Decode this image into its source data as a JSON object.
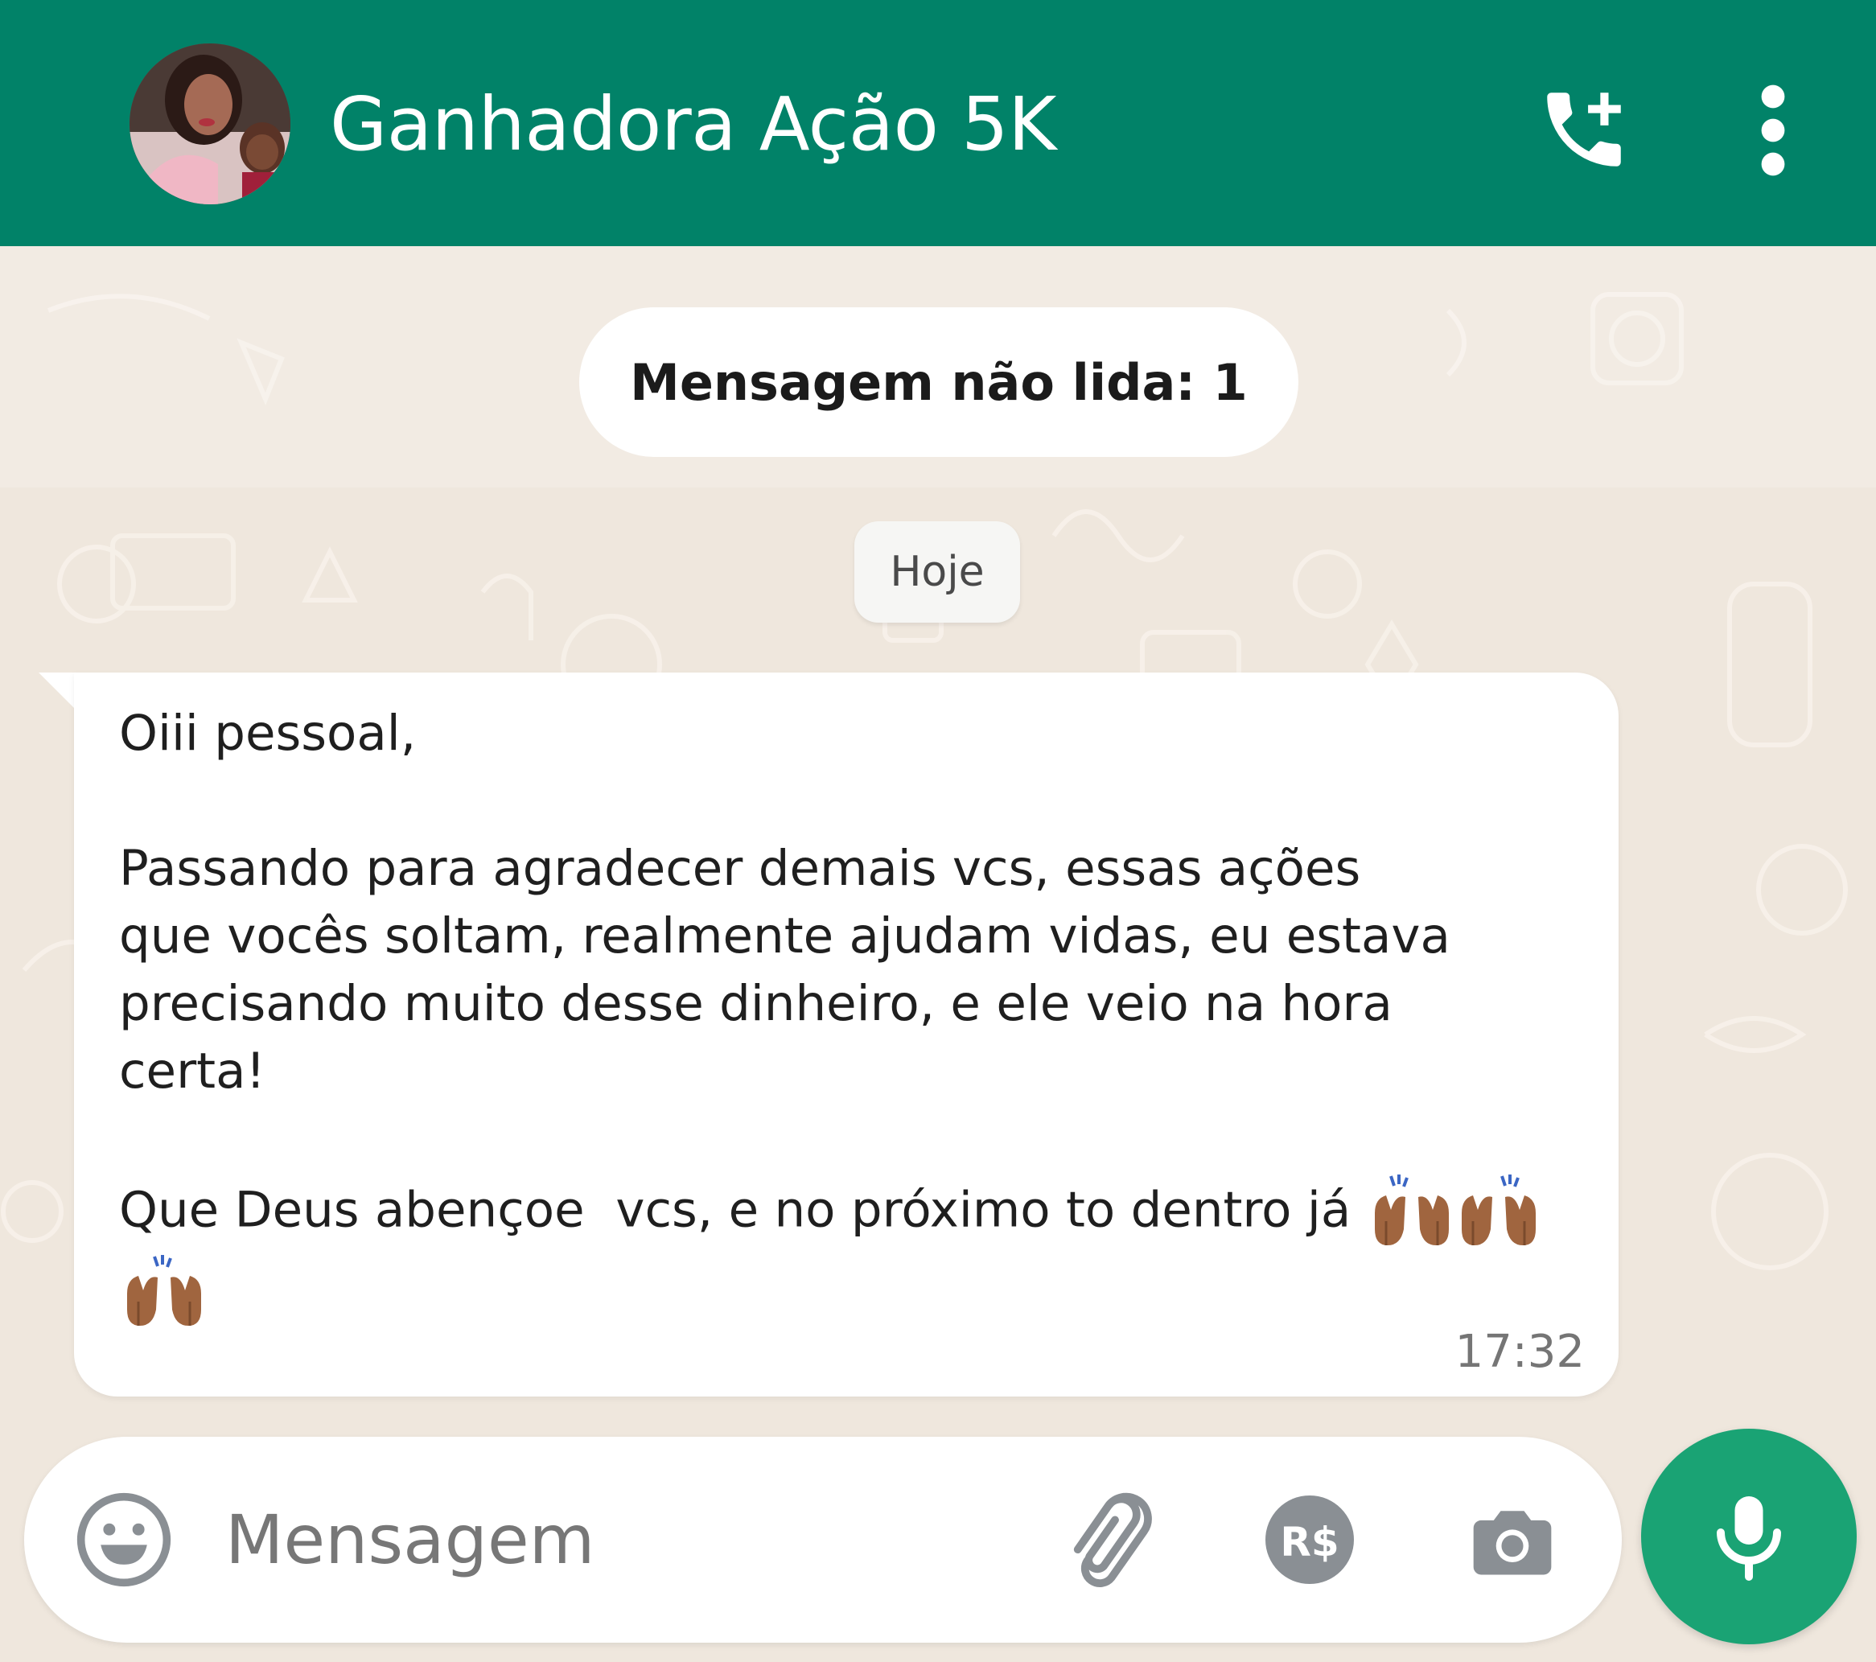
{
  "header": {
    "contact_name": "Ganhadora Ação 5K",
    "avatar_icon": "contact-avatar",
    "call_icon": "add-call-icon",
    "menu_icon": "more-vert-icon",
    "bar_color": "#018268"
  },
  "chat": {
    "unread_banner": "Mensagem não lida: 1",
    "date_label": "Hoje",
    "messages": [
      {
        "line1": "Oiii pessoal,",
        "paragraph2": "Passando para agradecer demais vcs, essas ações\nque vocês soltam, realmente ajudam vidas, eu estava\nprecisando muito desse dinheiro, e ele veio na hora\ncerta!",
        "paragraph3": "Que Deus abençoe  vcs, e no próximo to dentro já",
        "emoji_name": "raising-hands-medium-dark-skin-tone",
        "emoji_count": 4,
        "time": "17:32"
      }
    ]
  },
  "composer": {
    "placeholder": "Mensagem",
    "emoji_icon": "emoji-icon",
    "attach_icon": "paperclip-icon",
    "payment_icon": "rs-payment-icon",
    "payment_label": "R$",
    "camera_icon": "camera-icon",
    "mic_icon": "microphone-icon",
    "mic_color": "#1aa374"
  }
}
